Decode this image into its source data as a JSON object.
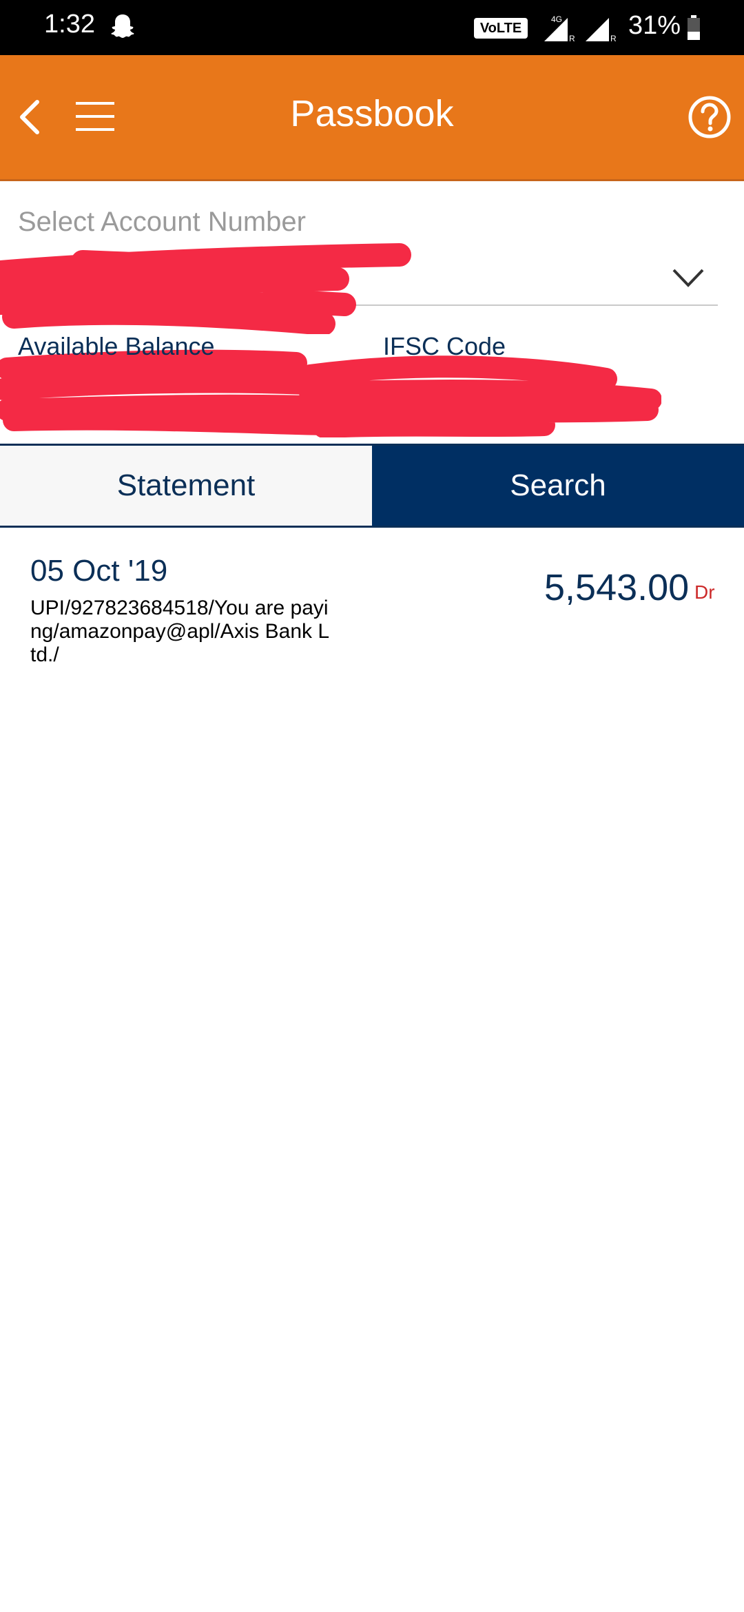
{
  "status_bar": {
    "time": "1:32",
    "volte": "VoLTE",
    "network": "4G",
    "battery": "31%"
  },
  "app_bar": {
    "title": "Passbook",
    "back_icon": "chevron-left-icon",
    "menu_icon": "hamburger-menu-icon",
    "help_icon": "question-circle-icon",
    "color": "#e8771a"
  },
  "account": {
    "label": "Select Account Number",
    "dropdown_icon": "chevron-down-icon"
  },
  "details": {
    "balance_label": "Available Balance",
    "ifsc_label": "IFSC Code"
  },
  "tabs": [
    {
      "label": "Statement",
      "active": false
    },
    {
      "label": "Search",
      "active": true
    }
  ],
  "transactions": [
    {
      "date": "05 Oct '19",
      "description": "UPI/927823684518/You are paying/amazonpay@apl/Axis Bank Ltd./",
      "amount": "5,543.00",
      "type": "Dr"
    }
  ],
  "colors": {
    "primary": "#0b2f57",
    "tab_active": "#002f63",
    "debit": "#cc2a2a",
    "redaction": "#f42a45"
  }
}
